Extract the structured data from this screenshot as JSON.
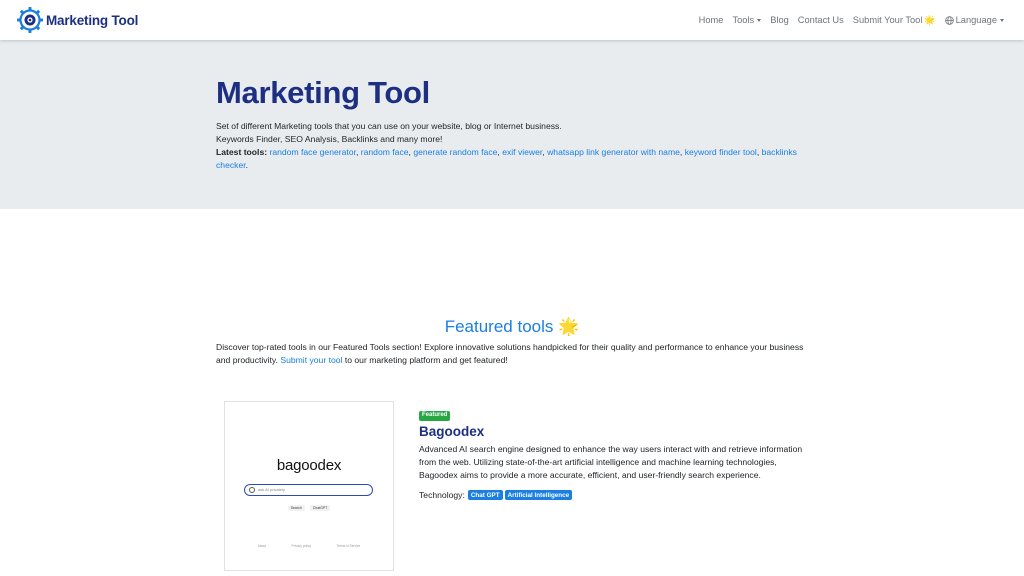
{
  "brand": {
    "name": "Marketing Tool"
  },
  "nav": {
    "home": "Home",
    "tools": "Tools",
    "blog": "Blog",
    "contact": "Contact Us",
    "submit": "Submit Your Tool",
    "submit_emoji": "🌟",
    "language": "Language"
  },
  "hero": {
    "title": "Marketing Tool",
    "line1": "Set of different Marketing tools that you can use on your website, blog or Internet business.",
    "line2": "Keywords Finder, SEO Analysis, Backlinks and many more!",
    "latest_label": "Latest tools:",
    "latest_tools": [
      "random face generator",
      "random face",
      "generate random face",
      "exif viewer",
      "whatsapp link generator with name",
      "keyword finder tool",
      "backlinks checker"
    ]
  },
  "featured": {
    "title": "Featured tools",
    "title_emoji": "🌟",
    "desc_before": "Discover top-rated tools in our Featured Tools section! Explore innovative solutions handpicked for their quality and performance to enhance your business and productivity.",
    "desc_link": "Submit your tool",
    "desc_after": "to our marketing platform and get featured!"
  },
  "tool": {
    "badge": "Featured",
    "name": "Bagoodex",
    "description": "Advanced AI search engine designed to enhance the way users interact with and retrieve information from the web. Utilizing state-of-the-art artificial intelligence and machine learning technologies, Bagoodex aims to provide a more accurate, efficient, and user-friendly search experience.",
    "technology_label": "Technology:",
    "technologies": [
      "Chat GPT",
      "Artificial Intelligence"
    ],
    "screenshot": {
      "logo": "bagoodex",
      "placeholder": "ask AI privately",
      "buttons": [
        "Search",
        "ChatGPT"
      ],
      "footer_links": [
        "About",
        "Privacy policy",
        "Terms of Service"
      ]
    }
  },
  "colors": {
    "brand_navy": "#1d2f82",
    "link_blue": "#1a7fe0",
    "badge_green": "#28a745",
    "hero_bg": "#e9ecef"
  }
}
